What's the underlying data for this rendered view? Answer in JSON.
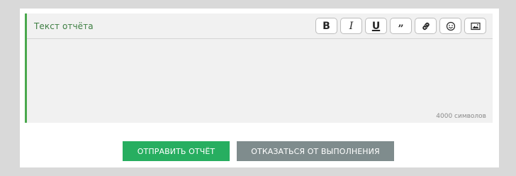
{
  "editor": {
    "title": "Текст отчёта",
    "char_counter": "4000 символов",
    "accent_color": "#4aa84d",
    "tools": [
      {
        "name": "bold",
        "glyph": "B"
      },
      {
        "name": "italic",
        "glyph": "I"
      },
      {
        "name": "underline",
        "glyph": "U"
      },
      {
        "name": "quote",
        "glyph": "”"
      },
      {
        "name": "link",
        "icon": "link-icon"
      },
      {
        "name": "emoji",
        "icon": "smiley-icon"
      },
      {
        "name": "image",
        "icon": "image-icon"
      }
    ]
  },
  "actions": {
    "submit_label": "ОТПРАВИТЬ ОТЧЁТ",
    "submit_color": "#27ae60",
    "decline_label": "ОТКАЗАТЬСЯ ОТ ВЫПОЛНЕНИЯ",
    "decline_color": "#7f8c8d"
  }
}
